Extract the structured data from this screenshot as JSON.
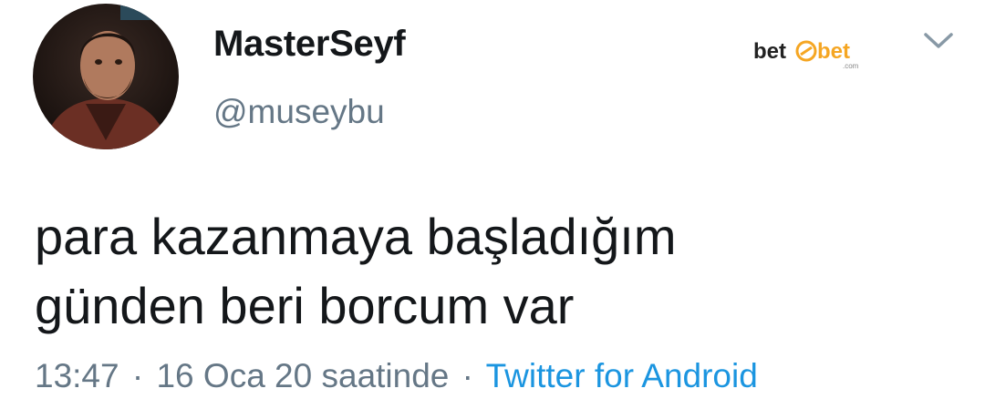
{
  "user": {
    "display_name": "MasterSeyf",
    "handle": "@museybu",
    "avatar_icon": "profile-photo"
  },
  "watermark": {
    "left": "bet",
    "right": "bet",
    "small": ".com"
  },
  "tweet": {
    "lines": [
      "para kazanmaya başladığım",
      "günden beri borcum var"
    ],
    "time": "13:47",
    "separator": "·",
    "date_text": "16 Oca 20 saatinde",
    "source": "Twitter for Android"
  },
  "colors": {
    "text": "#14171a",
    "secondary": "#657786",
    "link": "#1b95e0",
    "watermark_orange": "#f5a623"
  },
  "icons": {
    "menu": "chevron-down-icon"
  }
}
